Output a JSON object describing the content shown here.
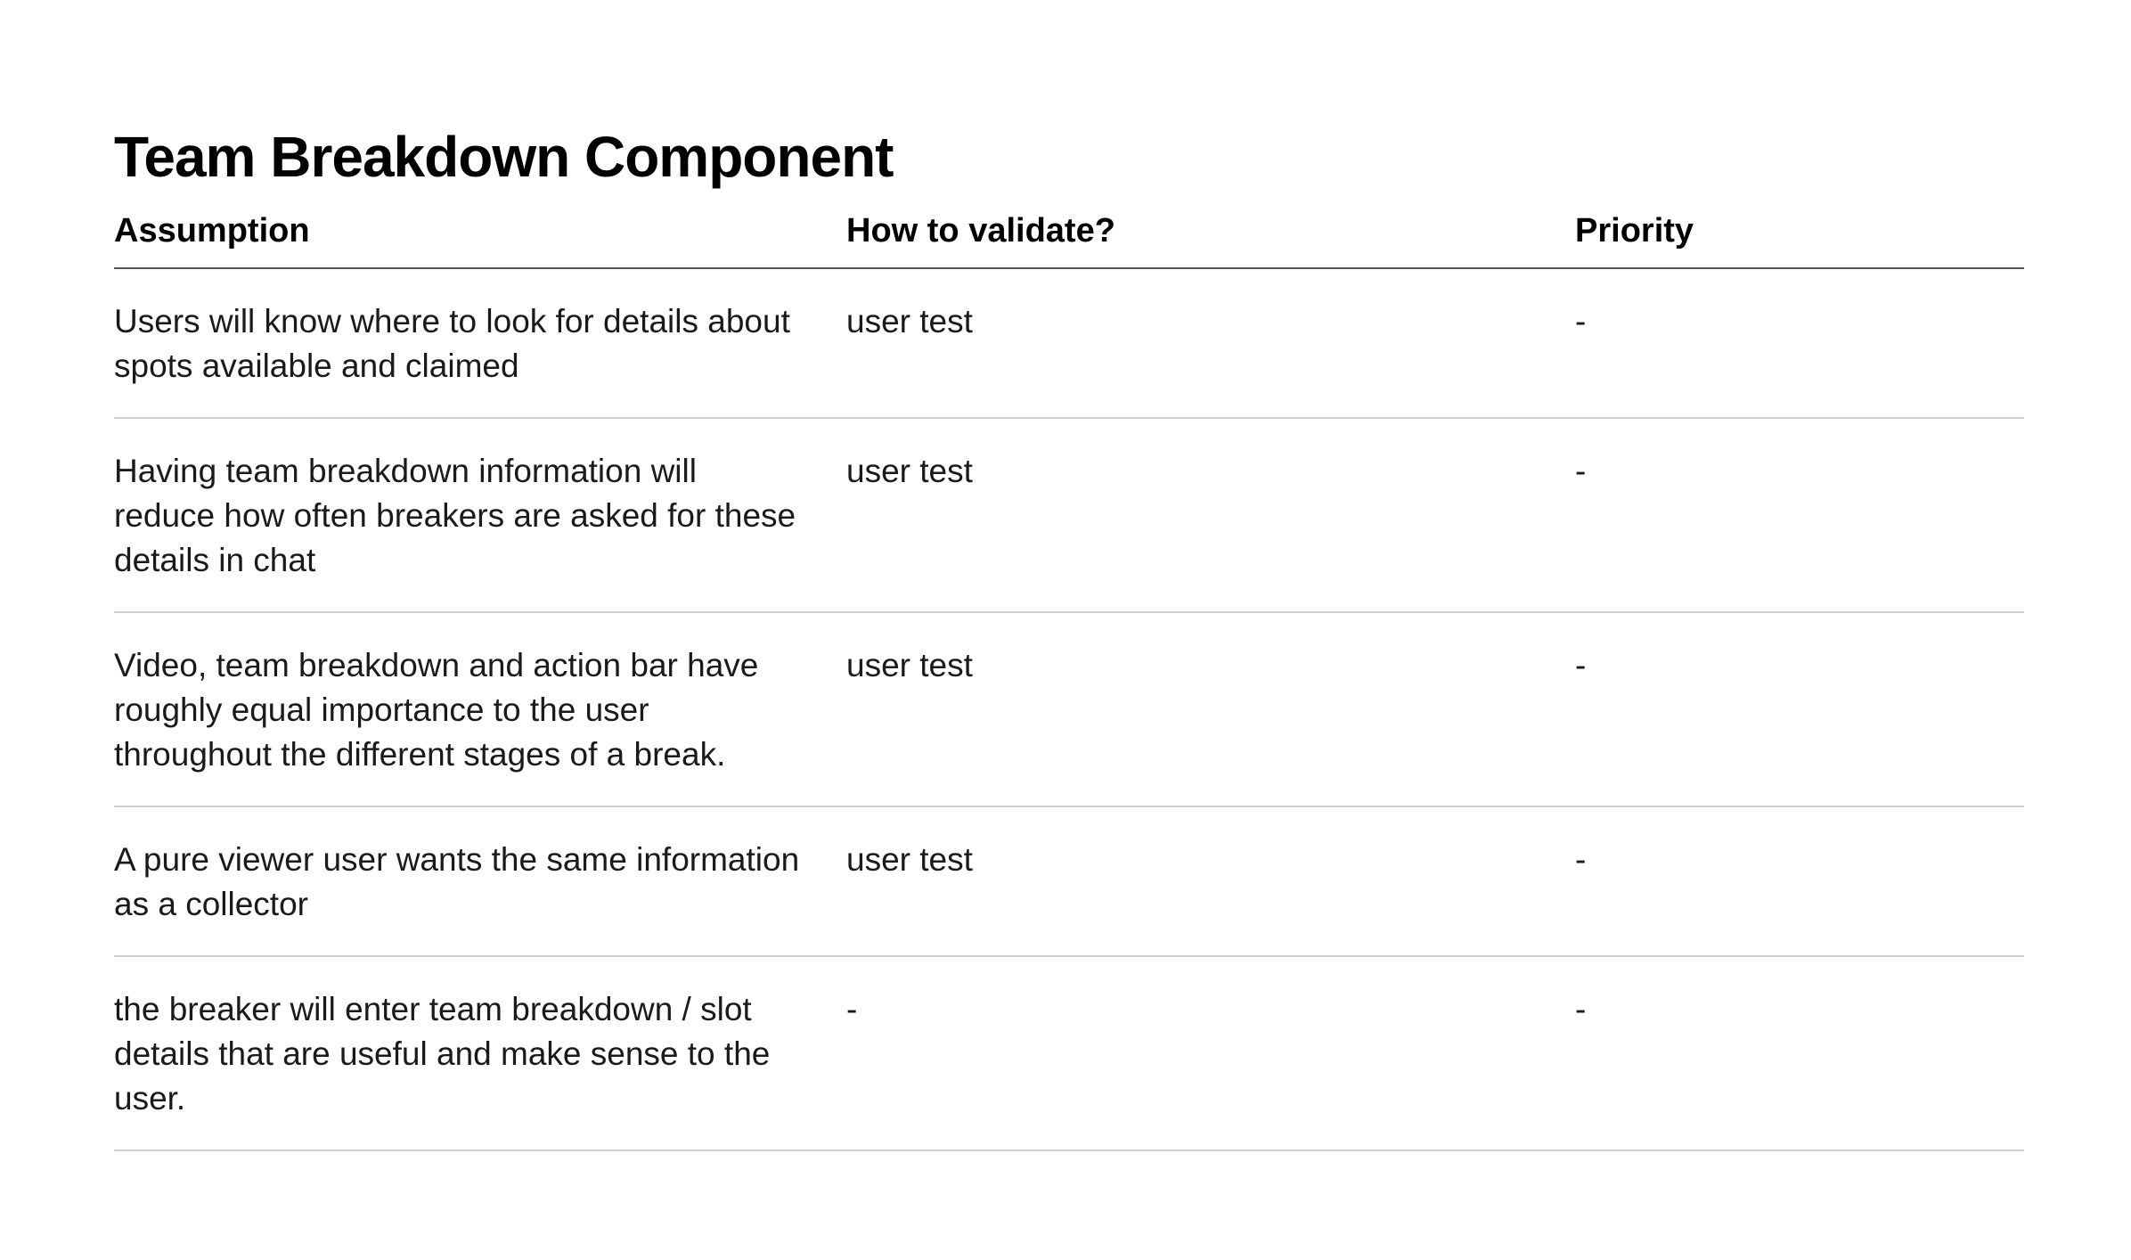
{
  "title": "Team Breakdown Component",
  "columns": {
    "assumption": "Assumption",
    "validate": "How to validate?",
    "priority": "Priority"
  },
  "rows": [
    {
      "assumption": "Users will know where to look for details about spots available and claimed",
      "validate": "user test",
      "priority": "-"
    },
    {
      "assumption": "Having team breakdown information will reduce how often breakers are asked for these details in chat",
      "validate": "user test",
      "priority": "-"
    },
    {
      "assumption": "Video, team breakdown and action bar have roughly equal importance to the user throughout the different stages of a break.",
      "validate": "user test",
      "priority": "-"
    },
    {
      "assumption": "A pure viewer user wants the same information as a collector",
      "validate": "user test",
      "priority": "-"
    },
    {
      "assumption": "the breaker will enter team breakdown / slot details that are useful and make sense to the user.",
      "validate": "-",
      "priority": "-"
    }
  ]
}
